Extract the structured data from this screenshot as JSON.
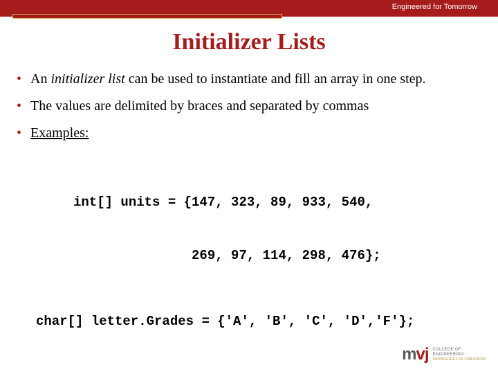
{
  "header": {
    "tagline": "Engineered for Tomorrow"
  },
  "title": "Initializer Lists",
  "bullets": [
    {
      "pre": "An ",
      "em": "initializer list",
      "post": " can be used to instantiate and fill an array in one step."
    },
    {
      "text": "The values are delimited by braces and separated by commas"
    },
    {
      "text_u": "Examples:"
    }
  ],
  "code": {
    "line1": "int[] units = {147, 323, 89, 933, 540,",
    "line1b": "               269, 97, 114, 298, 476};",
    "line2": "char[] letter.Grades = {'A', 'B', 'C', 'D','F'};"
  },
  "logo": {
    "m": "m",
    "vj": "vj",
    "line1": "COLLEGE OF",
    "line2": "ENGINEERING",
    "sub": "KNOWLEDGE FOR TOMORROW"
  }
}
